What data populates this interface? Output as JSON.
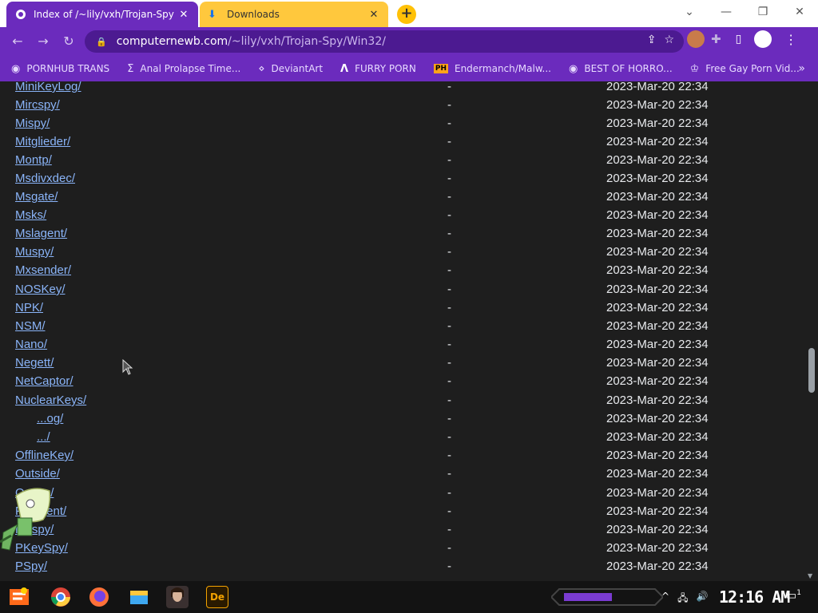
{
  "tabs": [
    {
      "title": "Index of /~lily/vxh/Trojan-Spy",
      "active": true,
      "close": "✕"
    },
    {
      "title": "Downloads",
      "active": false,
      "close": "✕"
    }
  ],
  "new_tab_label": "+",
  "window_controls": {
    "menu": "⌄",
    "minimize": "—",
    "restore": "❐",
    "close": "✕"
  },
  "nav": {
    "back": "←",
    "forward": "→",
    "reload": "↻"
  },
  "address": {
    "host": "computernewb.com",
    "path": "/~lily/vxh/Trojan-Spy/Win32/"
  },
  "bookmarks": [
    {
      "label": "PORNHUB TRANS",
      "icon": "globe-icon"
    },
    {
      "label": "Anal Prolapse Time...",
      "icon": "sigma-icon"
    },
    {
      "label": "DeviantArt",
      "icon": "deviantart-icon"
    },
    {
      "label": "FURRY PORN",
      "icon": "lambda-icon"
    },
    {
      "label": "Endermanch/Malw...",
      "icon": "ph-icon"
    },
    {
      "label": "BEST OF HORRO...",
      "icon": "globe-icon"
    },
    {
      "label": "Free Gay Porn Vid...",
      "icon": "trophy-icon"
    }
  ],
  "bookmarks_more": "»",
  "listing": [
    {
      "name": "MiniKeyLog/",
      "size": "-",
      "date": "2023-Mar-20 22:34"
    },
    {
      "name": "Mircspy/",
      "size": "-",
      "date": "2023-Mar-20 22:34"
    },
    {
      "name": "Mispy/",
      "size": "-",
      "date": "2023-Mar-20 22:34"
    },
    {
      "name": "Mitglieder/",
      "size": "-",
      "date": "2023-Mar-20 22:34"
    },
    {
      "name": "Montp/",
      "size": "-",
      "date": "2023-Mar-20 22:34"
    },
    {
      "name": "Msdivxdec/",
      "size": "-",
      "date": "2023-Mar-20 22:34"
    },
    {
      "name": "Msgate/",
      "size": "-",
      "date": "2023-Mar-20 22:34"
    },
    {
      "name": "Msks/",
      "size": "-",
      "date": "2023-Mar-20 22:34"
    },
    {
      "name": "Mslagent/",
      "size": "-",
      "date": "2023-Mar-20 22:34"
    },
    {
      "name": "Muspy/",
      "size": "-",
      "date": "2023-Mar-20 22:34"
    },
    {
      "name": "Mxsender/",
      "size": "-",
      "date": "2023-Mar-20 22:34"
    },
    {
      "name": "NOSKey/",
      "size": "-",
      "date": "2023-Mar-20 22:34"
    },
    {
      "name": "NPK/",
      "size": "-",
      "date": "2023-Mar-20 22:34"
    },
    {
      "name": "NSM/",
      "size": "-",
      "date": "2023-Mar-20 22:34"
    },
    {
      "name": "Nano/",
      "size": "-",
      "date": "2023-Mar-20 22:34"
    },
    {
      "name": "Negett/",
      "size": "-",
      "date": "2023-Mar-20 22:34"
    },
    {
      "name": "NetCaptor/",
      "size": "-",
      "date": "2023-Mar-20 22:34"
    },
    {
      "name": "NuclearKeys/",
      "size": "-",
      "date": "2023-Mar-20 22:34"
    },
    {
      "name": "...og/",
      "size": "-",
      "date": "2023-Mar-20 22:34"
    },
    {
      "name": ".../",
      "size": "-",
      "date": "2023-Mar-20 22:34"
    },
    {
      "name": "OfflineKey/",
      "size": "-",
      "date": "2023-Mar-20 22:34"
    },
    {
      "name": "Outside/",
      "size": "-",
      "date": "2023-Mar-20 22:34"
    },
    {
      "name": "Ozone/",
      "size": "-",
      "date": "2023-Mar-20 22:34"
    },
    {
      "name": "PCAgent/",
      "size": "-",
      "date": "2023-Mar-20 22:34"
    },
    {
      "name": "PCspy/",
      "size": "-",
      "date": "2023-Mar-20 22:34"
    },
    {
      "name": "PKeySpy/",
      "size": "-",
      "date": "2023-Mar-20 22:34"
    },
    {
      "name": "PSpy/",
      "size": "-",
      "date": "2023-Mar-20 22:34"
    }
  ],
  "taskbar": {
    "clock": "12:16 AM",
    "apps": [
      "start-icon",
      "chrome-icon",
      "firefox-icon",
      "file-explorer-icon",
      "portrait-icon",
      "dreamweaver-icon"
    ],
    "dreamweaver_label": "De",
    "tray": {
      "chevron": "^",
      "network": "🖧",
      "volume": "🔊"
    },
    "notifications": "1"
  },
  "colors": {
    "accent": "#6b2bbd",
    "link": "#8ab4f8",
    "tab_yellow": "#ffc83d"
  }
}
